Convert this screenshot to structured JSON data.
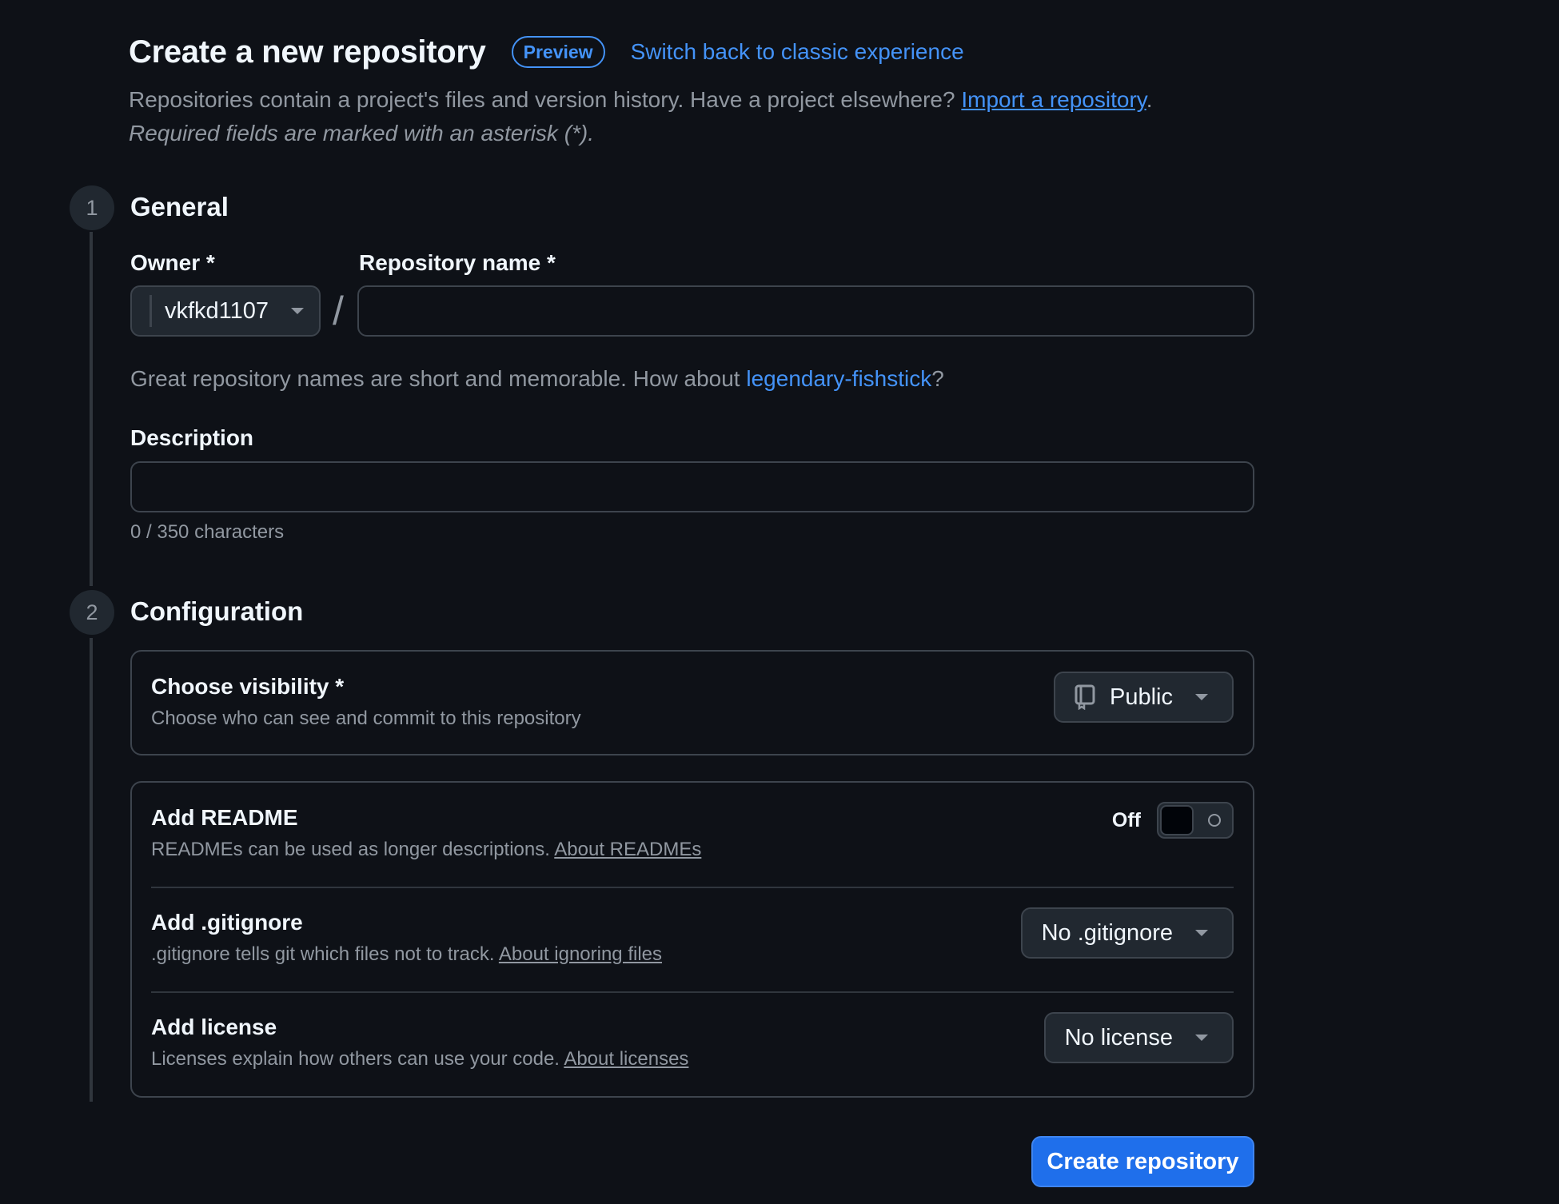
{
  "header": {
    "title": "Create a new repository",
    "preview_badge": "Preview",
    "switch_link": "Switch back to classic experience",
    "subtitle_text": "Repositories contain a project's files and version history. Have a project elsewhere?",
    "import_link": "Import a repository",
    "subtitle_end": ".",
    "required_note": "Required fields are marked with an asterisk (*)."
  },
  "steps": {
    "general": {
      "number": "1",
      "title": "General"
    },
    "configuration": {
      "number": "2",
      "title": "Configuration"
    }
  },
  "general": {
    "owner_label": "Owner *",
    "owner_value": "vkfkd1107",
    "slash": "/",
    "repo_name_label": "Repository name *",
    "repo_name_value": "",
    "name_hint_text": "Great repository names are short and memorable. How about",
    "name_suggestion": "legendary-fishstick",
    "name_hint_end": "?",
    "description_label": "Description",
    "description_value": "",
    "char_count": "0 / 350 characters"
  },
  "configuration": {
    "visibility": {
      "title": "Choose visibility *",
      "description": "Choose who can see and commit to this repository",
      "selected": "Public",
      "icon": "repo-icon"
    },
    "readme": {
      "title": "Add README",
      "description": "READMEs can be used as longer descriptions.",
      "about_link": "About READMEs",
      "toggle_label": "Off",
      "enabled": false
    },
    "gitignore": {
      "title": "Add .gitignore",
      "description": ".gitignore tells git which files not to track.",
      "about_link": "About ignoring files",
      "selected": "No .gitignore"
    },
    "license": {
      "title": "Add license",
      "description": "Licenses explain how others can use your code.",
      "about_link": "About licenses",
      "selected": "No license"
    }
  },
  "actions": {
    "create_button": "Create repository"
  },
  "colors": {
    "background": "#0e1117",
    "accent": "#4493f8",
    "primary_button": "#1f6feb",
    "border": "#3d444d",
    "muted_text": "#9198a1"
  }
}
